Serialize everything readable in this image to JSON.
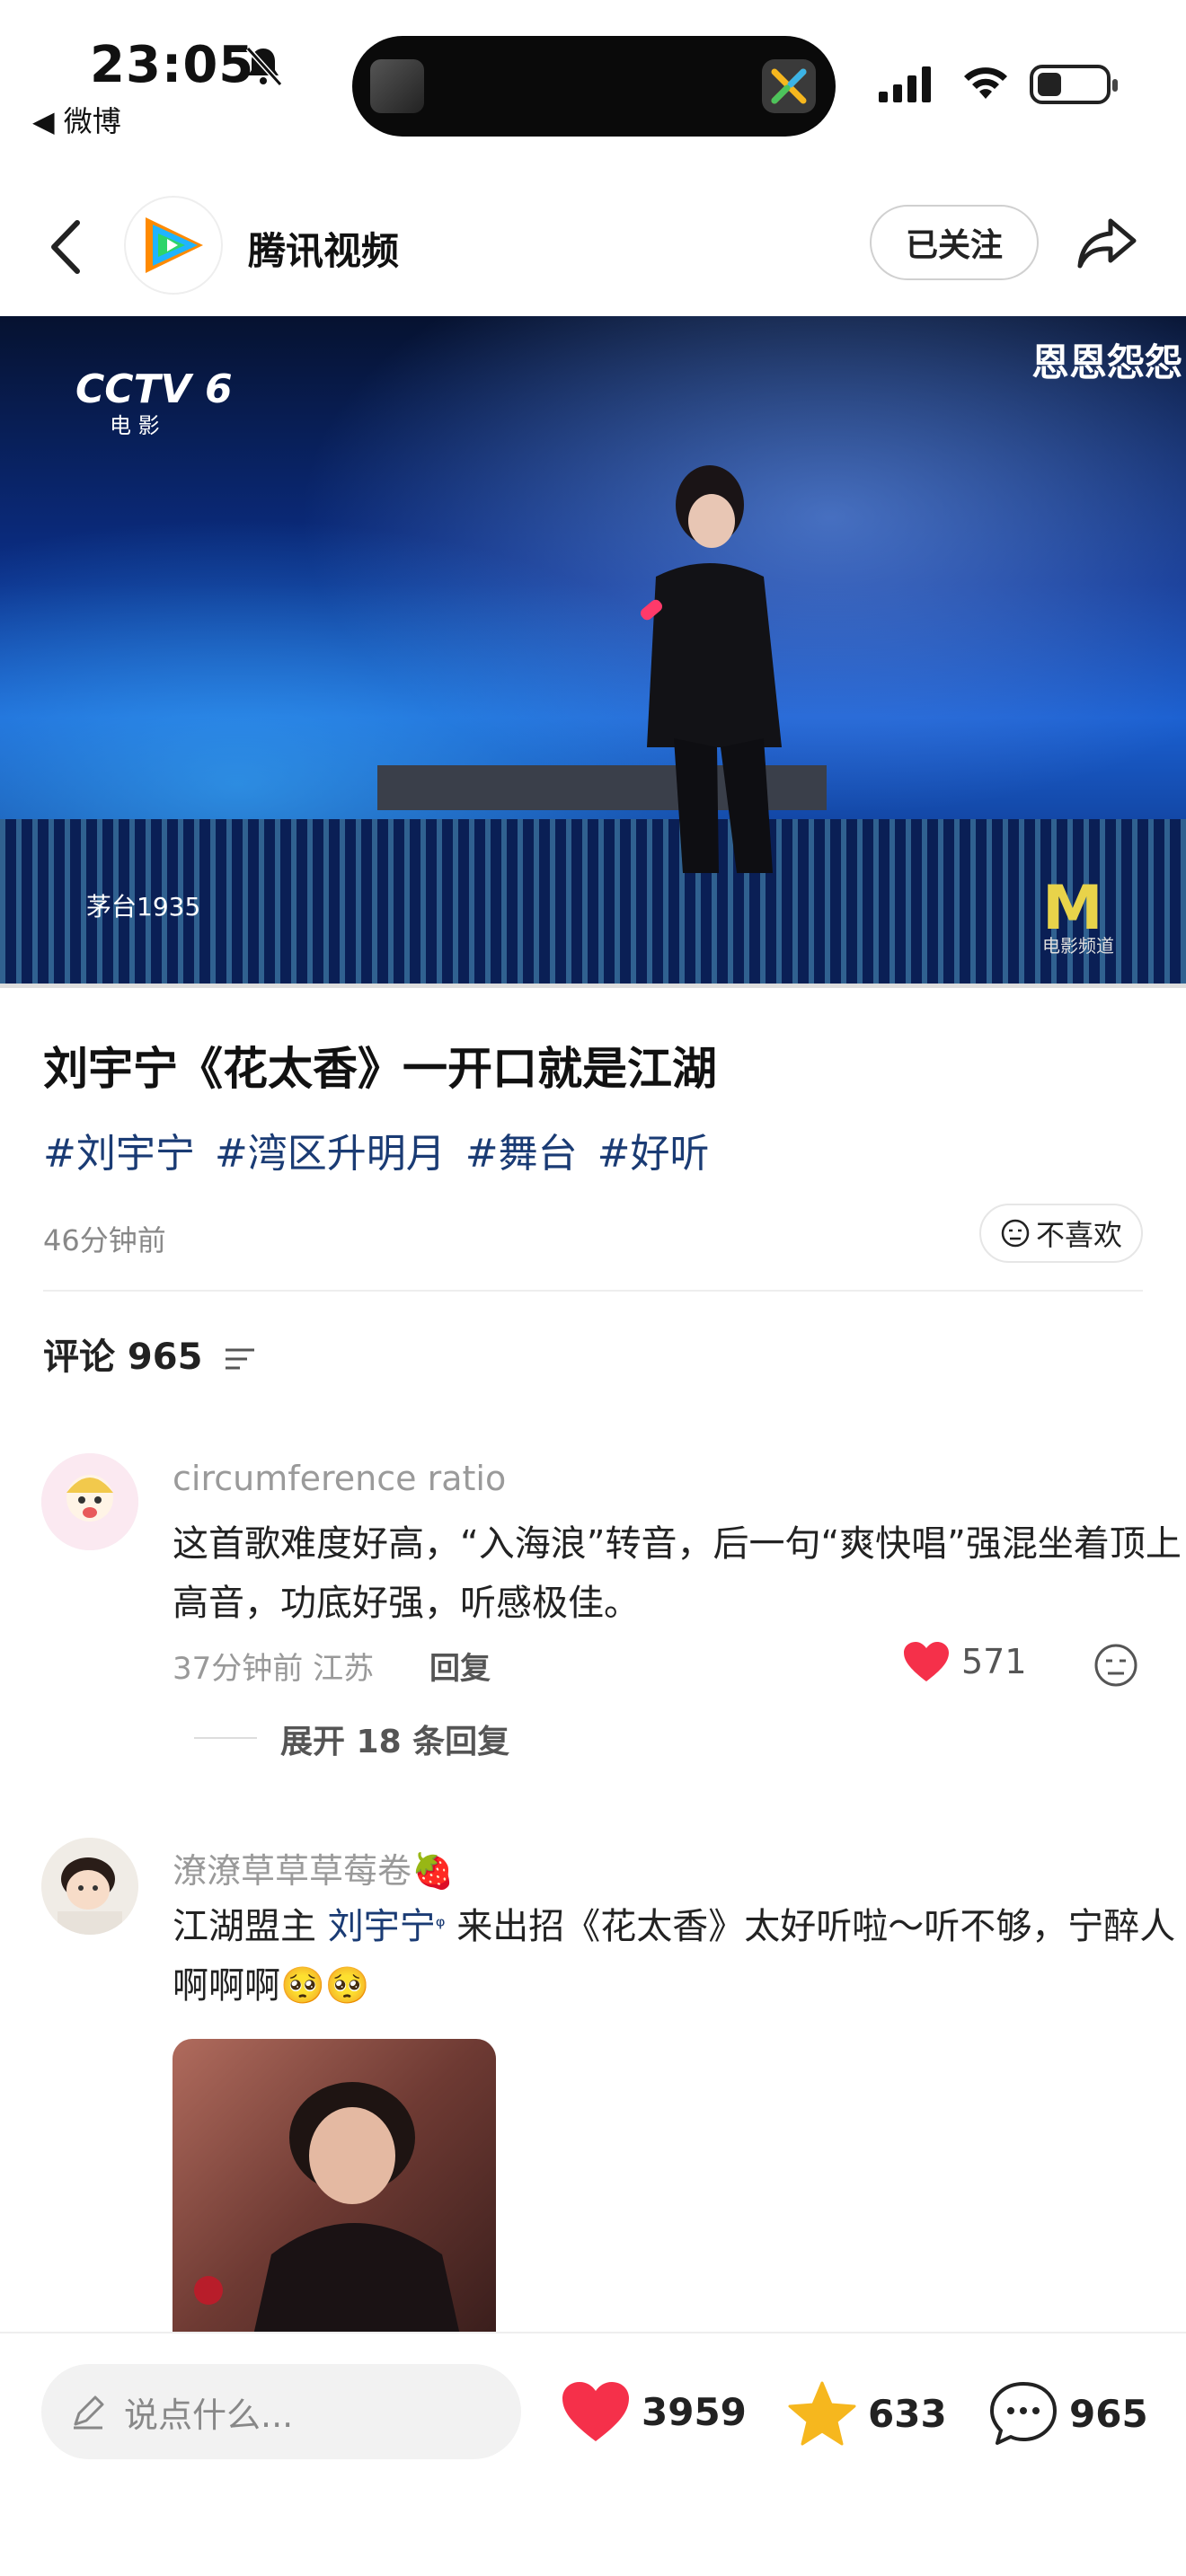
{
  "status_bar": {
    "time": "23:05",
    "back_app": "◀ 微博"
  },
  "header": {
    "title": "腾讯视频",
    "follow_label": "已关注"
  },
  "video": {
    "channel": "CCTV 6",
    "channel_sub": "电 影",
    "caption": "恩恩怨怨",
    "sponsor": "茅台1935",
    "corner_logo": "M",
    "corner_sub": "电影频道",
    "progress": 0.0
  },
  "post": {
    "title": "刘宇宁《花太香》一开口就是江湖",
    "tags": [
      "#刘宇宁",
      "#湾区升明月",
      "#舞台",
      "#好听"
    ],
    "posted": "46分钟前",
    "dislike_label": "不喜欢"
  },
  "comments_header": {
    "label": "评论 965"
  },
  "comments": [
    {
      "user": "circumference ratio",
      "text": "这首歌难度好高，“入海浪”转音，后一句“爽快唱”强混坐着顶上高音，功底好强，听感极佳。",
      "meta": "37分钟前 江苏",
      "reply_label": "回复",
      "likes": "571",
      "expand_label": "展开 18 条回复"
    },
    {
      "user": "潦潦草草草莓卷🍓",
      "text_before": "江湖盟主",
      "mention": "刘宇宁",
      "text_after": " 来出招《花太香》太好听啦～听不够，宁醉人啊啊啊🥺🥺"
    }
  ],
  "bottom_bar": {
    "input_placeholder": "说点什么...",
    "likes": "3959",
    "favorites": "633",
    "comments": "965"
  },
  "colors": {
    "accent_red": "#f5304a",
    "star_yellow": "#f6b71e",
    "tag_blue": "#1a3b74"
  }
}
